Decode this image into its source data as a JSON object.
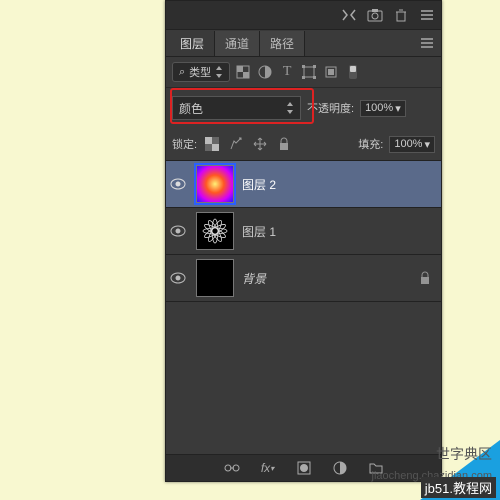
{
  "header": {},
  "tabs": {
    "layers": "图层",
    "channels": "通道",
    "paths": "路径"
  },
  "filter": {
    "kind_label": "类型",
    "search_glyph": "⌕"
  },
  "blend": {
    "mode": "颜色",
    "opacity_label": "不透明度:",
    "opacity_value": "100%"
  },
  "lock": {
    "label": "锁定:",
    "fill_label": "填充:",
    "fill_value": "100%"
  },
  "layers": [
    {
      "name": "图层 2",
      "selected": true,
      "thumb": "gradient",
      "locked": false
    },
    {
      "name": "图层 1",
      "selected": false,
      "thumb": "flower",
      "locked": false
    },
    {
      "name": "背景",
      "selected": false,
      "thumb": "black",
      "locked": true,
      "italic": true
    }
  ],
  "watermark": {
    "line1": "世字典区",
    "line2": "jiaocheng.chazidian.com",
    "line3": "jb51.教程网"
  },
  "icons": {
    "collapse": "▶◀",
    "camera": "camera",
    "trash": "trash",
    "menu": "≡",
    "eye": "◉",
    "lock": "🔒",
    "dropdown": "▾",
    "spinner": "⇅",
    "link": "⧉",
    "fx": "fx"
  }
}
